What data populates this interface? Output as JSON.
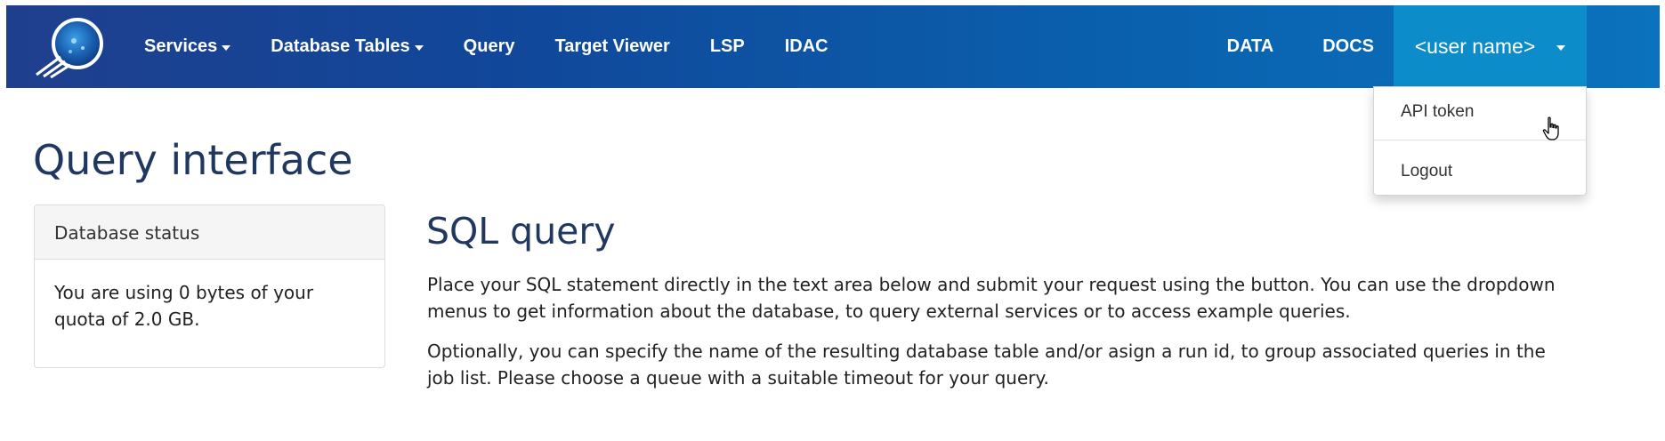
{
  "nav": {
    "services": "Services",
    "database_tables": "Database Tables",
    "query": "Query",
    "target_viewer": "Target Viewer",
    "lsp": "LSP",
    "idac": "IDAC",
    "data": "DATA",
    "docs": "DOCS",
    "user": "<user name>"
  },
  "user_menu": {
    "api_token": "API token",
    "logout": "Logout"
  },
  "page": {
    "title": "Query interface"
  },
  "status_panel": {
    "heading": "Database status",
    "body": "You are using 0 bytes of your quota of 2.0 GB."
  },
  "sql": {
    "title": "SQL query",
    "paragraph1": "Place your SQL statement directly in the text area below and submit your request using the button. You can use the dropdown menus to get information about the database, to query external services or to access example queries.",
    "paragraph2": "Optionally, you can specify the name of the resulting database table and/or asign a run id, to group associated queries in the job list. Please choose a queue with a suitable timeout for your query."
  },
  "colors": {
    "navbar_start": "#1f3f8d",
    "navbar_end": "#0b72bd",
    "user_toggle": "#0c8cc9",
    "heading": "#20385f"
  },
  "icons": {
    "logo": "comet-globe-logo",
    "cursor": "hand-pointer-cursor"
  }
}
